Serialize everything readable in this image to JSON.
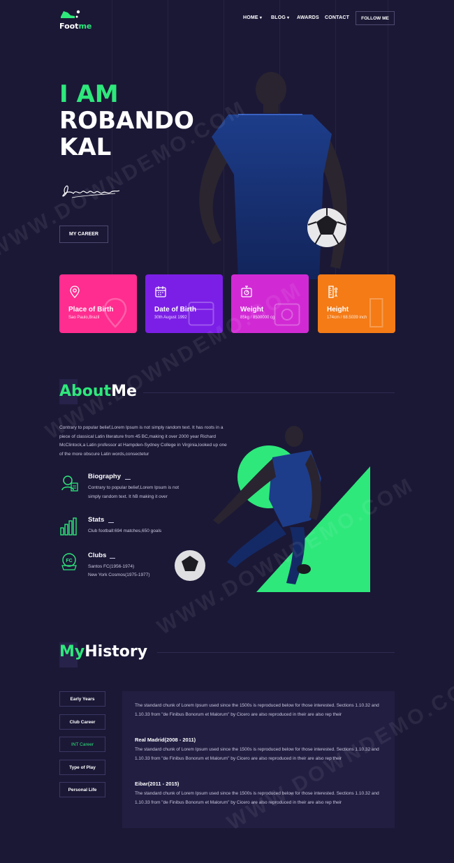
{
  "header": {
    "logo_text_white": "Foot",
    "logo_text_green": "me",
    "nav": [
      {
        "label": "HOME",
        "caret": true
      },
      {
        "label": "BLOG",
        "caret": true
      },
      {
        "label": "AWARDS",
        "caret": false
      },
      {
        "label": "CONTACT",
        "caret": false
      }
    ],
    "follow_label": "FOLLOW ME"
  },
  "hero": {
    "line1": "I AM",
    "line2": "ROBANDO",
    "line3": "KAL",
    "signature_text": "Signature",
    "career_button": "MY CAREER"
  },
  "cards": [
    {
      "title": "Place of Birth",
      "value": "Sao Paulo,Brazil",
      "color": "#ff2d8f",
      "icon": "location-pin-icon"
    },
    {
      "title": "Date of Birth",
      "value": "30th August 1992",
      "color": "#7b1fe6",
      "icon": "calendar-icon"
    },
    {
      "title": "Weight",
      "value": "85kg / 8500000 cg",
      "color": "#d12ad4",
      "icon": "scale-icon"
    },
    {
      "title": "Height",
      "value": "174cm / 68.5039 inch",
      "color": "#f47b16",
      "icon": "ruler-icon"
    }
  ],
  "about": {
    "heading_green": "About",
    "heading_white": "Me",
    "text": "Contrary to popular belief,Lorem Ipsum is not simply random text. It has roots in a piece of classical Latin literature from 45 BC,making it over 2000 year Richard McClintock,a Latin professor at Hampden-Sydney College in Virginia,looked up one of the more obscure Latin words,consectetur",
    "features": [
      {
        "title": "Biography",
        "body": "Contrary to popular belief,Lorem Ipsum is not simply random text. It hB making it over",
        "icon": "biography-icon"
      },
      {
        "title": "Stats",
        "body": "Club football:694 matches,650 goals",
        "icon": "stats-bars-icon"
      },
      {
        "title": "Clubs",
        "body": "Santos FC(1956-1974)\nNew York Cosmos(1975-1977)",
        "icon": "club-badge-icon"
      }
    ],
    "clubs_line1": "Santos FC(1956-1974)",
    "clubs_line2": "New York Cosmos(1975-1977)"
  },
  "history": {
    "heading_green": "My",
    "heading_white": "History",
    "tabs": [
      "Early Years",
      "Club Career",
      "INT Career",
      "Type of Play",
      "Personal Life"
    ],
    "active_tab": "INT Career",
    "intro": "The standard chunk of Lorem Ipsum used since the 1500s is reproduced below for those interested. Sections 1.10.32 and 1.10.33 from \"de Finibus Bonorum et Malorum\" by Cicero are also reproduced in their are also rep their",
    "entries": [
      {
        "title": "Real Madrid(2008 - 2011)",
        "body": "The standard chunk of Lorem Ipsum used since the 1500s is reproduced below for those interested. Sections 1.10.32 and 1.10.33 from \"de Finibus Bonorum et Malorum\" by Cicero are also reproduced in their are also rep their"
      },
      {
        "title": "Eibar(2011 - 2015)",
        "body": "The standard chunk of Lorem Ipsum used since the 1500s is reproduced below for those interested. Sections 1.10.32 and 1.10.33 from \"de Finibus Bonorum et Malorum\" by Cicero are also reproduced in their are also rep their"
      }
    ]
  },
  "watermark": "WWW.DOWNDEMO.COM",
  "colors": {
    "accent": "#2ee87b",
    "background": "#1b1836",
    "panel": "#211e42"
  }
}
